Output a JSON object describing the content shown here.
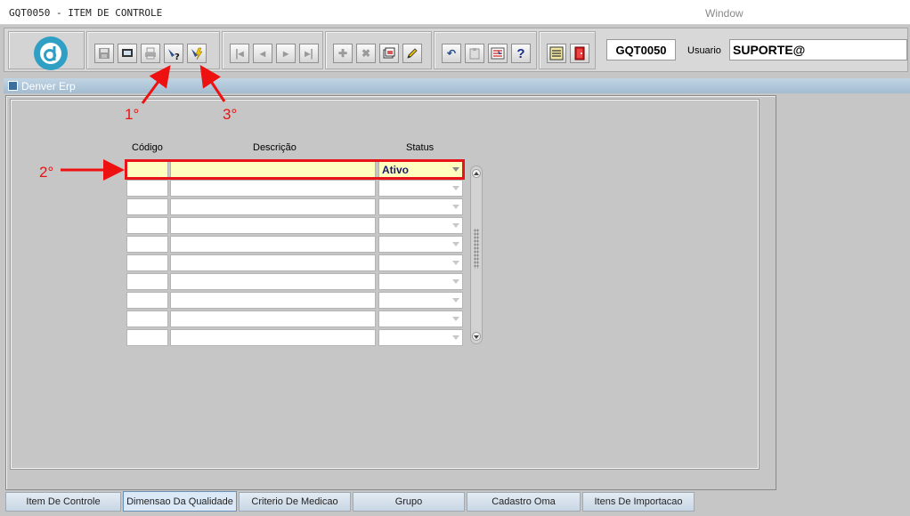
{
  "window": {
    "title": "GQT0050 - ITEM DE CONTROLE",
    "menu_window": "Window"
  },
  "toolbar": {
    "form_code": "GQT0050",
    "user_label": "Usuario",
    "user_value": "SUPORTE@",
    "buttons": [
      {
        "name": "save",
        "icon": "save-icon"
      },
      {
        "name": "print-screen",
        "icon": "screen-icon"
      },
      {
        "name": "print",
        "icon": "printer-icon"
      },
      {
        "name": "enter-query",
        "icon": "query-enter-icon"
      },
      {
        "name": "execute-query",
        "icon": "query-execute-icon"
      },
      {
        "name": "first-record",
        "icon": "first-icon"
      },
      {
        "name": "previous-record",
        "icon": "previous-icon"
      },
      {
        "name": "next-record",
        "icon": "next-icon"
      },
      {
        "name": "last-record",
        "icon": "last-icon"
      },
      {
        "name": "insert-record",
        "icon": "plus-icon"
      },
      {
        "name": "delete-record",
        "icon": "x-icon"
      },
      {
        "name": "duplicate-record",
        "icon": "duplicate-icon"
      },
      {
        "name": "edit-record",
        "icon": "pencil-icon"
      },
      {
        "name": "undo",
        "icon": "undo-icon"
      },
      {
        "name": "clipboard",
        "icon": "clipboard-icon"
      },
      {
        "name": "list-of-values",
        "icon": "lov-icon"
      },
      {
        "name": "help",
        "icon": "help-icon"
      },
      {
        "name": "menu",
        "icon": "menu-icon"
      },
      {
        "name": "exit",
        "icon": "exit-icon"
      }
    ]
  },
  "app_bar": {
    "title": "Denver Erp"
  },
  "grid": {
    "headers": {
      "code": "Código",
      "description": "Descrição",
      "status": "Status"
    },
    "rows": [
      {
        "code": "",
        "description": "",
        "status": "Ativo"
      },
      {
        "code": "",
        "description": "",
        "status": ""
      },
      {
        "code": "",
        "description": "",
        "status": ""
      },
      {
        "code": "",
        "description": "",
        "status": ""
      },
      {
        "code": "",
        "description": "",
        "status": ""
      },
      {
        "code": "",
        "description": "",
        "status": ""
      },
      {
        "code": "",
        "description": "",
        "status": ""
      },
      {
        "code": "",
        "description": "",
        "status": ""
      },
      {
        "code": "",
        "description": "",
        "status": ""
      },
      {
        "code": "",
        "description": "",
        "status": ""
      }
    ]
  },
  "tabs": [
    {
      "label": "Item De Controle",
      "active": false
    },
    {
      "label": "Dimensao Da Qualidade",
      "active": true
    },
    {
      "label": "Criterio De Medicao",
      "active": false
    },
    {
      "label": "Grupo",
      "active": false
    },
    {
      "label": "Cadastro Oma",
      "active": false
    },
    {
      "label": "Itens De Importacao",
      "active": false
    }
  ],
  "annotations": {
    "step1": "1°",
    "step2": "2°",
    "step3": "3°",
    "color": "#ee1111"
  }
}
